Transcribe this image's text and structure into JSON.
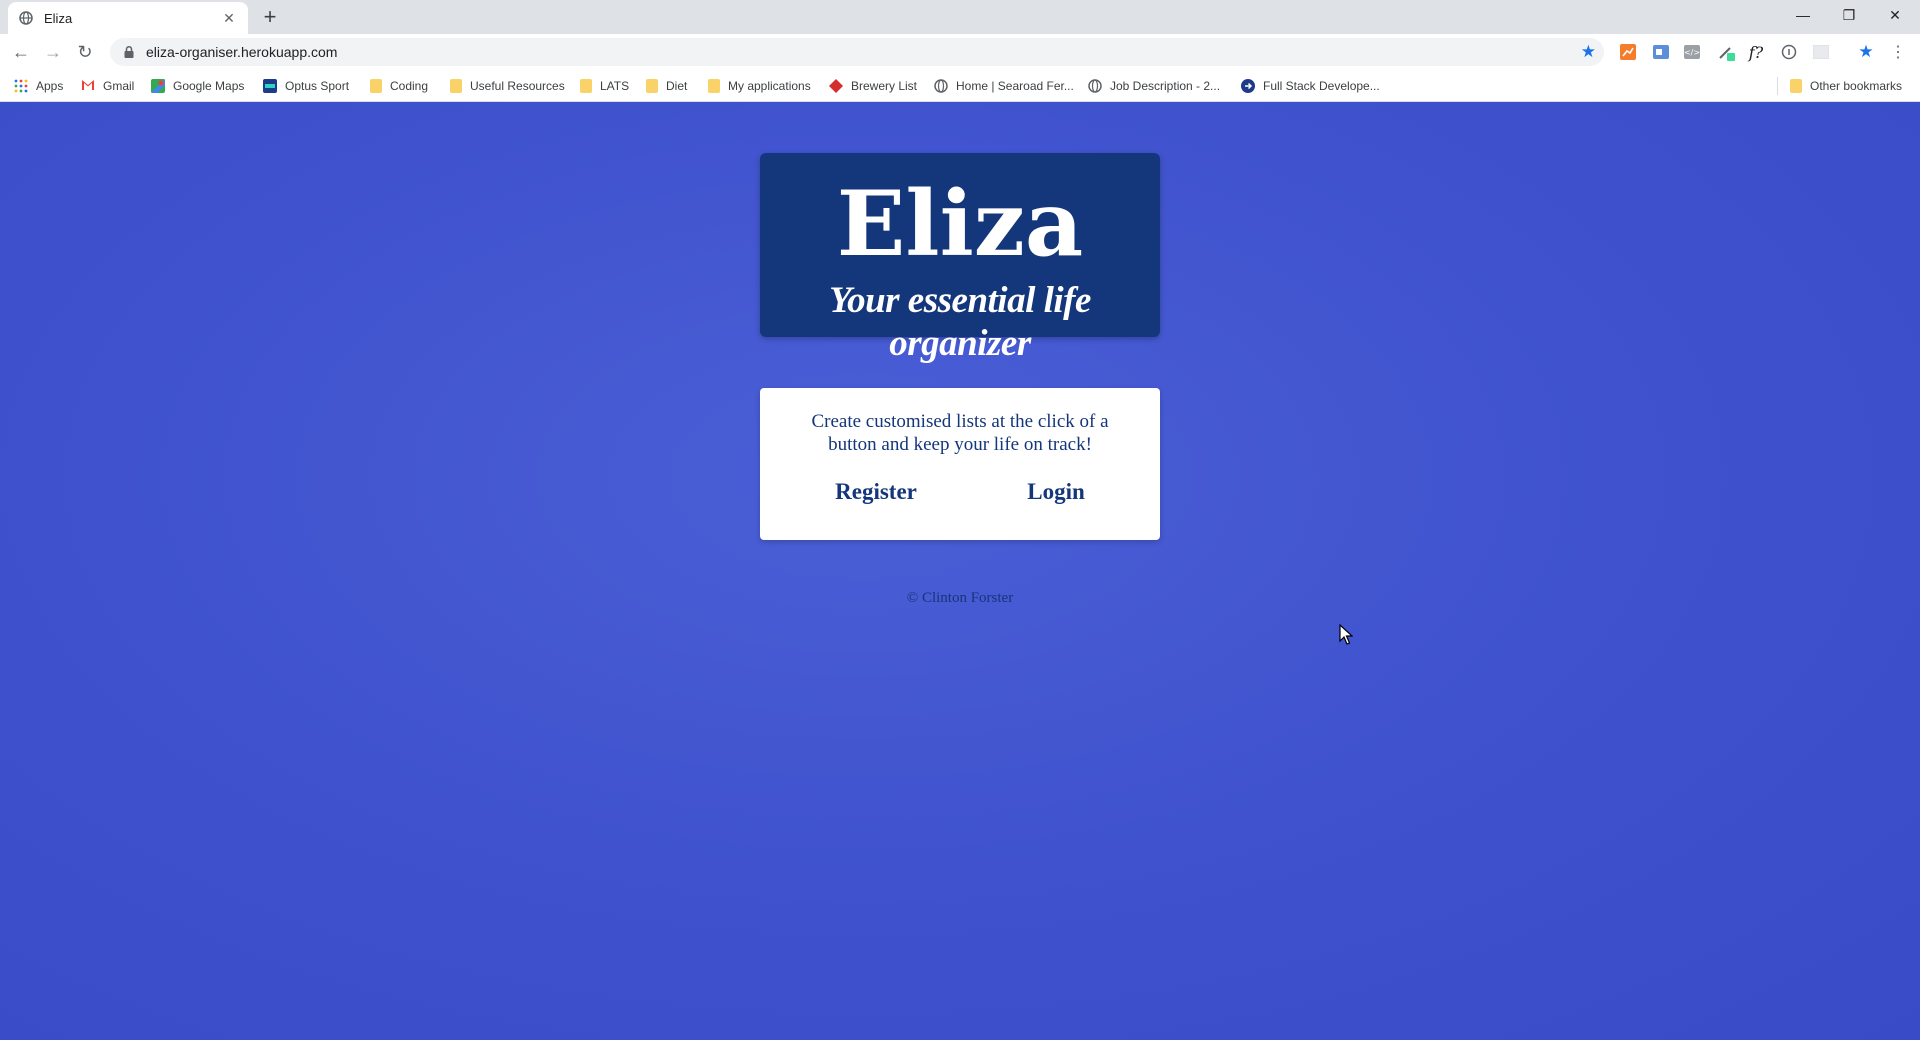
{
  "browser": {
    "tab": {
      "title": "Eliza",
      "close_glyph": "✕",
      "icon": "globe-icon"
    },
    "new_tab_glyph": "+",
    "window_controls": {
      "minimize": "—",
      "restore": "❐",
      "close": "✕"
    },
    "nav": {
      "back": "←",
      "forward": "→",
      "reload": "↻"
    },
    "address": {
      "url": "eliza-organiser.herokuapp.com",
      "bookmark_star": "★"
    },
    "bookmarks": [
      {
        "label": "Apps",
        "icon": "apps-grid-icon"
      },
      {
        "label": "Gmail",
        "icon": "gmail-icon"
      },
      {
        "label": "Google Maps",
        "icon": "maps-icon"
      },
      {
        "label": "Optus Sport",
        "icon": "optus-sport-icon"
      },
      {
        "label": "Coding",
        "icon": "folder-icon"
      },
      {
        "label": "Useful Resources",
        "icon": "folder-icon"
      },
      {
        "label": "LATS",
        "icon": "folder-icon"
      },
      {
        "label": "Diet",
        "icon": "folder-icon"
      },
      {
        "label": "My applications",
        "icon": "folder-icon"
      },
      {
        "label": "Brewery List",
        "icon": "brewery-icon"
      },
      {
        "label": "Home | Searoad Fer...",
        "icon": "globe-icon"
      },
      {
        "label": "Job Description - 2...",
        "icon": "globe-icon"
      },
      {
        "label": "Full Stack Develope...",
        "icon": "arrow-circle-icon"
      }
    ],
    "other_bookmarks": "Other bookmarks"
  },
  "page": {
    "brand": "Eliza",
    "tagline": "Your essential life organizer",
    "intro": "Create customised lists at the click of a button and keep your life on track!",
    "register_label": "Register",
    "login_label": "Login",
    "footer": "© Clinton Forster"
  },
  "colors": {
    "background": "#3f51cd",
    "hero": "#14367b",
    "card": "#ffffff",
    "text": "#14367b"
  }
}
